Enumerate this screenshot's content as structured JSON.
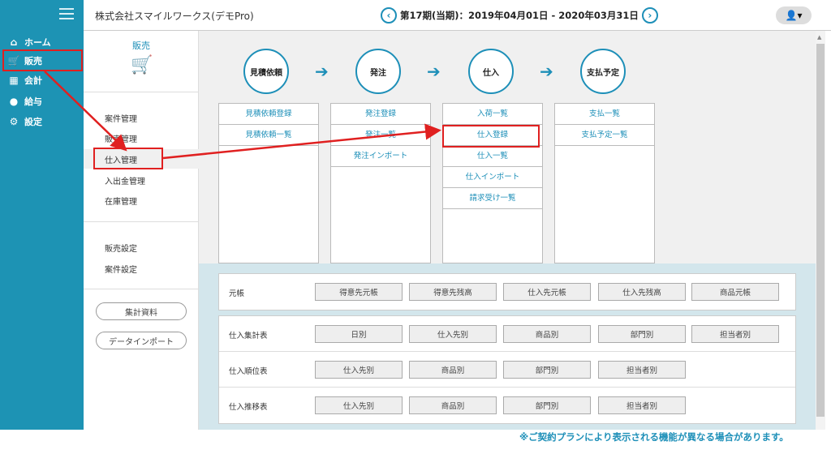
{
  "nav": {
    "items": [
      {
        "label": "ホーム",
        "icon": "home-icon",
        "glyph": "⌂"
      },
      {
        "label": "販売",
        "icon": "cart-icon",
        "glyph": "🛒"
      },
      {
        "label": "会計",
        "icon": "calculator-icon",
        "glyph": "▦"
      },
      {
        "label": "給与",
        "icon": "money-bag-icon",
        "glyph": "●"
      },
      {
        "label": "設定",
        "icon": "gear-icon",
        "glyph": "⚙"
      }
    ]
  },
  "header": {
    "company": "株式会社スマイルワークス(デモPro)",
    "period": "第17期(当期)：2019年04月01日 - 2020年03月31日",
    "prev_glyph": "‹",
    "next_glyph": "›",
    "user_glyph": "👤▾"
  },
  "subnav": {
    "title": "販売",
    "cart_glyph": "🛒",
    "group1": [
      "案件管理",
      "販売管理",
      "仕入管理",
      "入出金管理",
      "在庫管理"
    ],
    "group2": [
      "販売設定",
      "案件設定"
    ],
    "pills": [
      "集計資料",
      "データインポート"
    ]
  },
  "flow": {
    "steps": [
      "見積依頼",
      "発注",
      "仕入",
      "支払予定"
    ],
    "arrow_glyph": "➔",
    "columns": [
      [
        "見積依頼登録",
        "見積依頼一覧"
      ],
      [
        "発注登録",
        "発注一覧",
        "発注インポート"
      ],
      [
        "入荷一覧",
        "仕入登録",
        "仕入一覧",
        "仕入インポート",
        "請求受け一覧"
      ],
      [
        "支払一覧",
        "支払予定一覧"
      ]
    ]
  },
  "panels": {
    "ledger": {
      "label": "元帳",
      "buttons": [
        "得意先元帳",
        "得意先残高",
        "仕入先元帳",
        "仕入先残高",
        "商品元帳"
      ]
    },
    "reports": [
      {
        "label": "仕入集計表",
        "buttons": [
          "日別",
          "仕入先別",
          "商品別",
          "部門別",
          "担当者別"
        ]
      },
      {
        "label": "仕入順位表",
        "buttons": [
          "仕入先別",
          "商品別",
          "部門別",
          "担当者別"
        ]
      },
      {
        "label": "仕入推移表",
        "buttons": [
          "仕入先別",
          "商品別",
          "部門別",
          "担当者別"
        ]
      }
    ]
  },
  "footnote": "※ご契約プランにより表示される機能が異なる場合があります。",
  "colors": {
    "accent": "#1d93b4",
    "highlight": "#e02020"
  }
}
